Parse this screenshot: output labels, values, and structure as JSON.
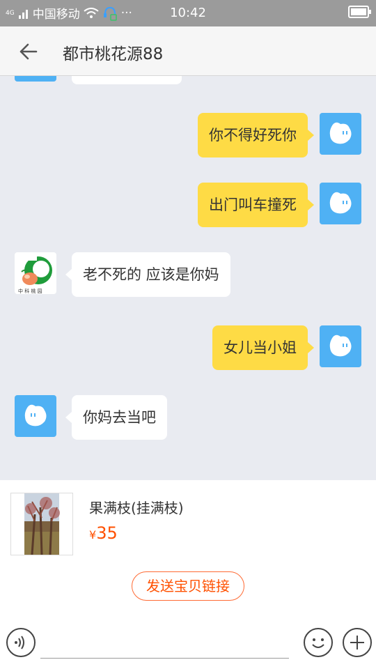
{
  "status_bar": {
    "network": "4G",
    "carrier": "中国移动",
    "time": "10:42"
  },
  "header": {
    "title": "都市桃花源88"
  },
  "messages": [
    {
      "side": "right",
      "text": "你不得好死你"
    },
    {
      "side": "right",
      "text": "出门叫车撞死"
    },
    {
      "side": "left",
      "text": "老不死的 应该是你妈"
    },
    {
      "side": "right",
      "text": "女儿当小姐"
    },
    {
      "side": "left",
      "text": "你妈去当吧"
    }
  ],
  "product": {
    "name": "果满枝(挂满枝)",
    "currency": "¥",
    "price": "35",
    "send_label": "发送宝贝链接"
  },
  "colors": {
    "accent": "#ff5000",
    "bubble_self": "#fedb45",
    "avatar_blue": "#4fb1f4"
  }
}
